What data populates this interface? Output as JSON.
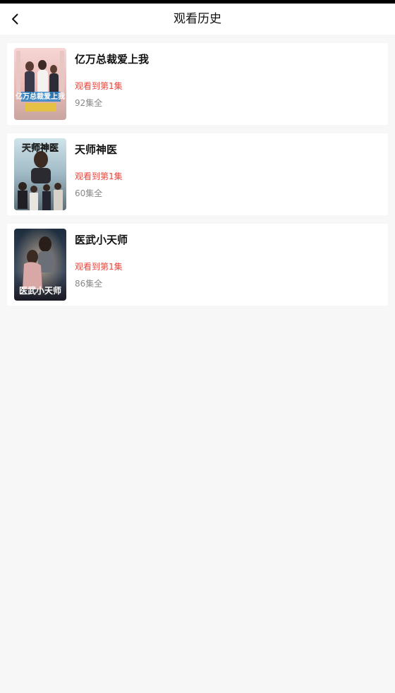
{
  "header": {
    "title": "观看历史",
    "back_icon": "chevron-left-icon"
  },
  "colors": {
    "progress": "#e8443a",
    "background": "#f7f7f7",
    "card": "#ffffff"
  },
  "items": [
    {
      "title": "亿万总裁爱上我",
      "progress": "观看到第1集",
      "episodes": "92集全",
      "poster_text": "亿万总裁爱上我"
    },
    {
      "title": "天师神医",
      "progress": "观看到第1集",
      "episodes": "60集全",
      "poster_text": "天师神医"
    },
    {
      "title": "医武小天师",
      "progress": "观看到第1集",
      "episodes": "86集全",
      "poster_text": "医武小天师"
    }
  ]
}
